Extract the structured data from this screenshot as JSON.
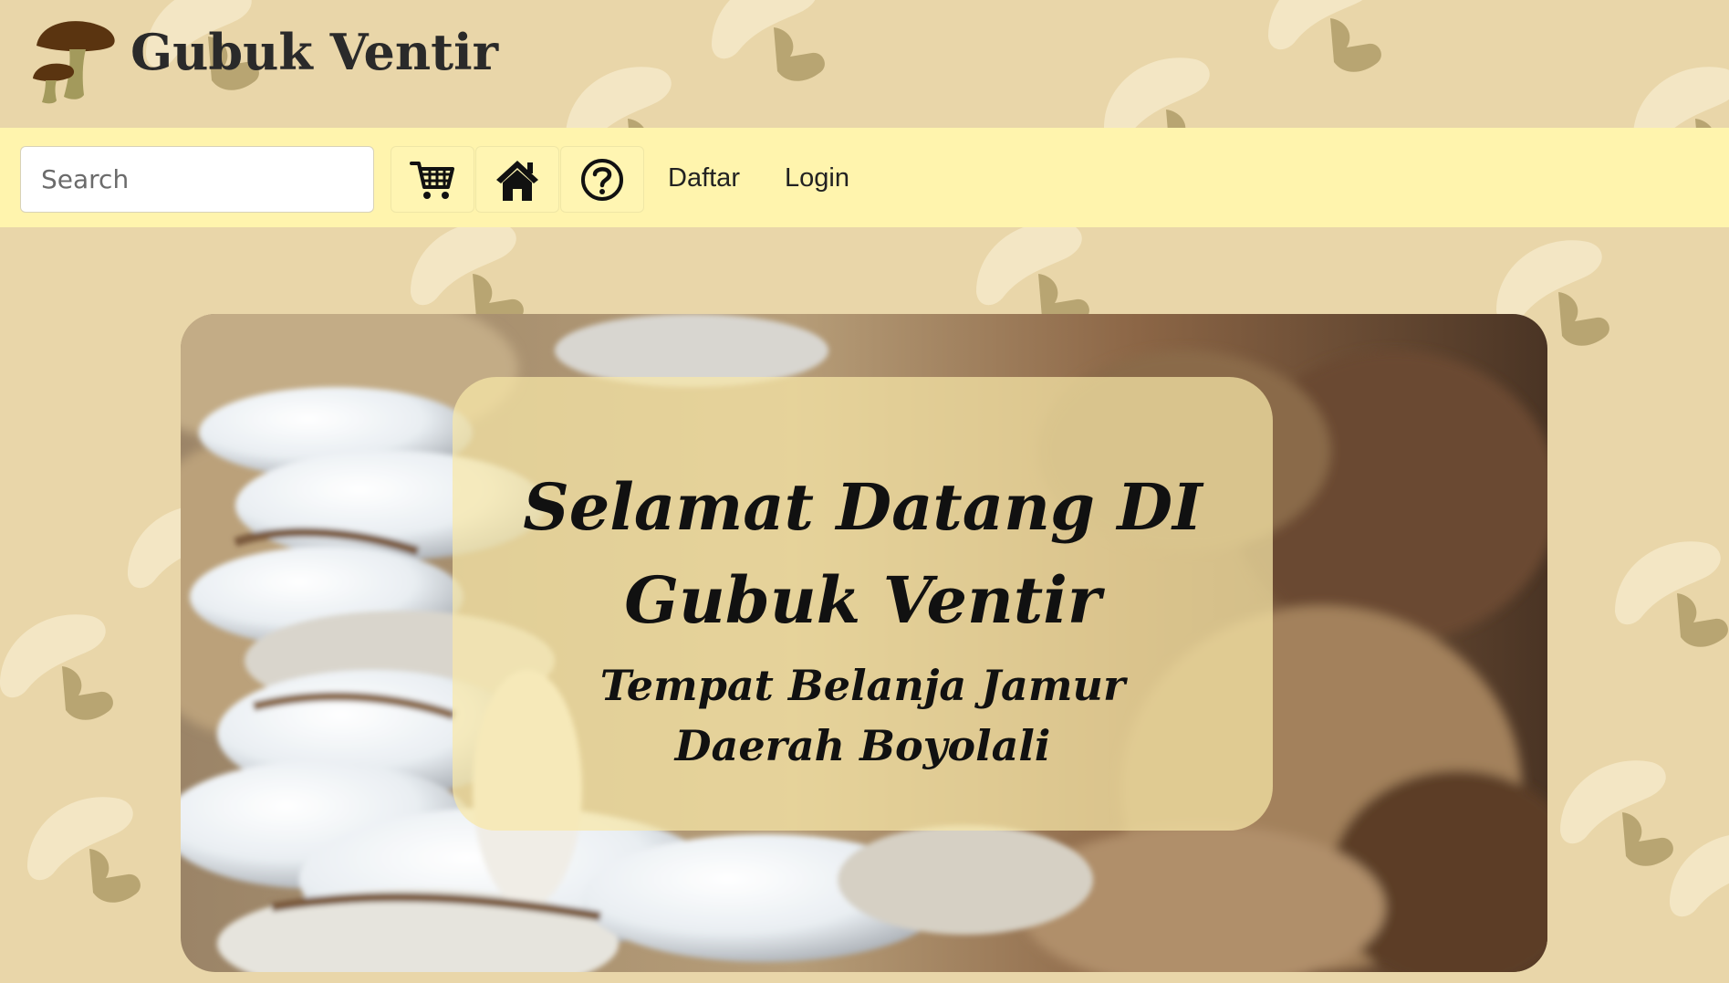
{
  "site": {
    "title": "Gubuk Ventir",
    "logo_icon": "mushroom-logo-icon"
  },
  "navbar": {
    "search_placeholder": "Search",
    "search_value": "",
    "cart_icon": "cart-icon",
    "home_icon": "home-icon",
    "help_icon": "help-icon",
    "links": {
      "register": "Daftar",
      "login": "Login"
    }
  },
  "hero": {
    "heading_line1": "Selamat Datang DI",
    "heading_line2": "Gubuk Ventir",
    "subheading_line1": "Tempat Belanja Jamur",
    "subheading_line2": "Daerah Boyolali"
  },
  "colors": {
    "page_background": "#e9d6a9",
    "navbar_background": "#fff4ad",
    "hero_card_background": "#f8e8a8",
    "logo_brown": "#5a3410",
    "text_dark": "#111111"
  }
}
